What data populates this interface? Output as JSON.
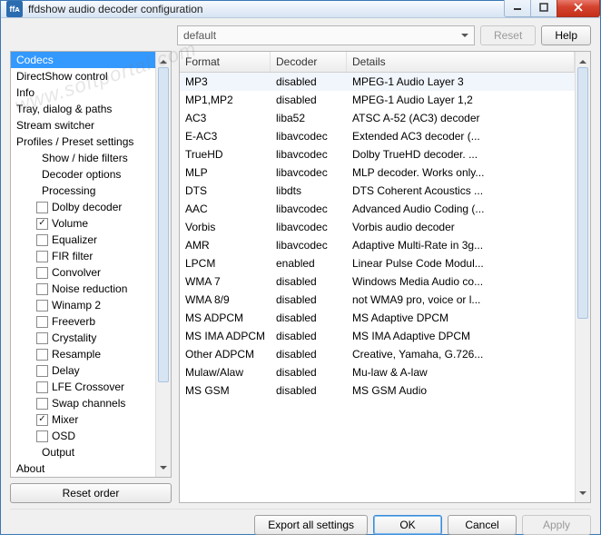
{
  "window": {
    "title": "ffdshow audio decoder configuration",
    "app_icon_text": "ffᴀ"
  },
  "top": {
    "preset": "default",
    "reset": "Reset",
    "help": "Help"
  },
  "tree": [
    {
      "label": "Codecs",
      "selected": true
    },
    {
      "label": "DirectShow control"
    },
    {
      "label": "Info"
    },
    {
      "label": "Tray, dialog & paths"
    },
    {
      "label": "Stream switcher"
    },
    {
      "label": "Profiles / Preset settings"
    },
    {
      "label": "Show / hide filters",
      "indent": 1
    },
    {
      "label": "Decoder options",
      "indent": 1
    },
    {
      "label": "Processing",
      "indent": 1
    },
    {
      "label": "Dolby decoder",
      "indent": 2,
      "check": false
    },
    {
      "label": "Volume",
      "indent": 2,
      "check": true
    },
    {
      "label": "Equalizer",
      "indent": 2,
      "check": false
    },
    {
      "label": "FIR filter",
      "indent": 2,
      "check": false
    },
    {
      "label": "Convolver",
      "indent": 2,
      "check": false
    },
    {
      "label": "Noise reduction",
      "indent": 2,
      "check": false
    },
    {
      "label": "Winamp 2",
      "indent": 2,
      "check": false
    },
    {
      "label": "Freeverb",
      "indent": 2,
      "check": false
    },
    {
      "label": "Crystality",
      "indent": 2,
      "check": false
    },
    {
      "label": "Resample",
      "indent": 2,
      "check": false
    },
    {
      "label": "Delay",
      "indent": 2,
      "check": false
    },
    {
      "label": "LFE Crossover",
      "indent": 2,
      "check": false
    },
    {
      "label": "Swap channels",
      "indent": 2,
      "check": false
    },
    {
      "label": "Mixer",
      "indent": 2,
      "check": true
    },
    {
      "label": "OSD",
      "indent": 2,
      "check": false
    },
    {
      "label": "Output",
      "indent": 1
    },
    {
      "label": "About"
    }
  ],
  "reset_order": "Reset order",
  "grid": {
    "headers": [
      "Format",
      "Decoder",
      "Details"
    ],
    "rows": [
      {
        "f": "MP3",
        "d": "disabled",
        "det": "MPEG-1 Audio Layer 3",
        "sel": true
      },
      {
        "f": "MP1,MP2",
        "d": "disabled",
        "det": "MPEG-1 Audio Layer 1,2"
      },
      {
        "f": "AC3",
        "d": "liba52",
        "det": "ATSC A-52 (AC3) decoder"
      },
      {
        "f": "E-AC3",
        "d": "libavcodec",
        "det": "Extended AC3 decoder (..."
      },
      {
        "f": "TrueHD",
        "d": "libavcodec",
        "det": "Dolby TrueHD decoder. ..."
      },
      {
        "f": "MLP",
        "d": "libavcodec",
        "det": "MLP decoder. Works only..."
      },
      {
        "f": "DTS",
        "d": "libdts",
        "det": "DTS Coherent Acoustics ..."
      },
      {
        "f": "AAC",
        "d": "libavcodec",
        "det": "Advanced Audio Coding (..."
      },
      {
        "f": "Vorbis",
        "d": "libavcodec",
        "det": "Vorbis audio decoder"
      },
      {
        "f": "AMR",
        "d": "libavcodec",
        "det": "Adaptive Multi-Rate in 3g..."
      },
      {
        "f": "LPCM",
        "d": "enabled",
        "det": "Linear Pulse Code Modul..."
      },
      {
        "f": "WMA 7",
        "d": "disabled",
        "det": "Windows Media Audio co..."
      },
      {
        "f": "WMA 8/9",
        "d": "disabled",
        "det": "not WMA9 pro, voice or l..."
      },
      {
        "f": "MS ADPCM",
        "d": "disabled",
        "det": "MS Adaptive DPCM"
      },
      {
        "f": "MS IMA ADPCM",
        "d": "disabled",
        "det": "MS IMA Adaptive DPCM"
      },
      {
        "f": "Other ADPCM",
        "d": "disabled",
        "det": "Creative, Yamaha, G.726..."
      },
      {
        "f": "Mulaw/Alaw",
        "d": "disabled",
        "det": "Mu-law & A-law"
      },
      {
        "f": "MS GSM",
        "d": "disabled",
        "det": "MS GSM Audio"
      }
    ]
  },
  "bottom": {
    "export": "Export all settings",
    "ok": "OK",
    "cancel": "Cancel",
    "apply": "Apply"
  }
}
